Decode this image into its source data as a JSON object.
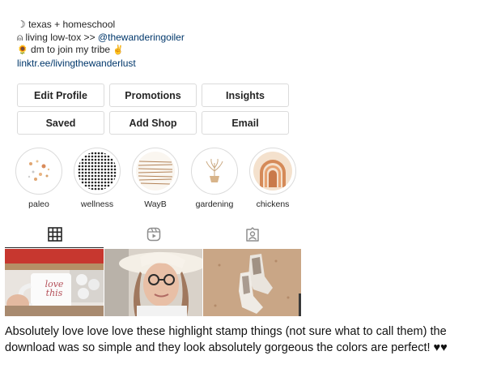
{
  "bio": {
    "line1": "☽ texas + homeschool",
    "line2_prefix": "⍝ living low-tox >> ",
    "line2_mention": "@thewanderingoiler",
    "line3_icon": "🌻",
    "line3_text": " dm to join my tribe ",
    "line3_emoji": "✌",
    "link": "linktr.ee/livingthewanderlust"
  },
  "buttons": {
    "edit_profile": "Edit Profile",
    "promotions": "Promotions",
    "insights": "Insights",
    "saved": "Saved",
    "add_shop": "Add Shop",
    "email": "Email"
  },
  "highlights": [
    {
      "label": "paleo"
    },
    {
      "label": "wellness"
    },
    {
      "label": "WayB"
    },
    {
      "label": "gardening"
    },
    {
      "label": "chickens"
    }
  ],
  "tabs": {
    "grid": "grid-icon",
    "reels": "reels-icon",
    "tagged": "tagged-icon"
  },
  "photos": {
    "mug_text": "love this"
  },
  "comment": "Absolutely love love love these highlight stamp things (not sure what to call them) the download was so simple and they look absolutely gorgeous the colors are perfect! ♥♥",
  "colors": {
    "link": "#00376b",
    "border": "#dbdbdb",
    "text": "#262626",
    "rainbow_orange": "#d58a58"
  }
}
